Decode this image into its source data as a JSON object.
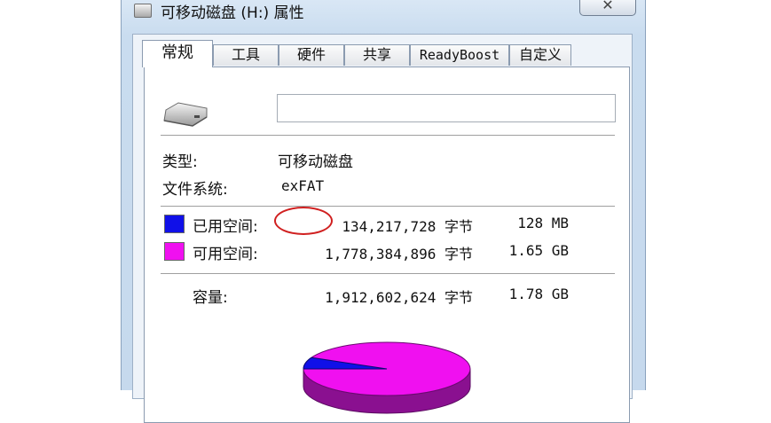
{
  "window": {
    "title": "可移动磁盘 (H:) 属性",
    "close_symbol": "✕"
  },
  "tabs": [
    {
      "label": "常规",
      "active": true
    },
    {
      "label": "工具"
    },
    {
      "label": "硬件"
    },
    {
      "label": "共享"
    },
    {
      "label": "ReadyBoost"
    },
    {
      "label": "自定义"
    }
  ],
  "general": {
    "volume_name_value": "",
    "type_label": "类型:",
    "type_value": "可移动磁盘",
    "filesystem_label": "文件系统:",
    "filesystem_value": "exFAT",
    "used": {
      "label": "已用空间:",
      "bytes": "134,217,728 字节",
      "size": "128 MB",
      "color": "#1010e8"
    },
    "free": {
      "label": "可用空间:",
      "bytes": "1,778,384,896 字节",
      "size": "1.65 GB",
      "color": "#f010f0"
    },
    "capacity": {
      "label": "容量:",
      "bytes": "1,912,602,624 字节",
      "size": "1.78 GB"
    }
  },
  "pie": {
    "used_fraction": 0.0702,
    "used_color": "#1010e8",
    "free_color": "#f010f0",
    "free_side_color": "#8a1090",
    "used_side_color": "#0a0a8a"
  }
}
